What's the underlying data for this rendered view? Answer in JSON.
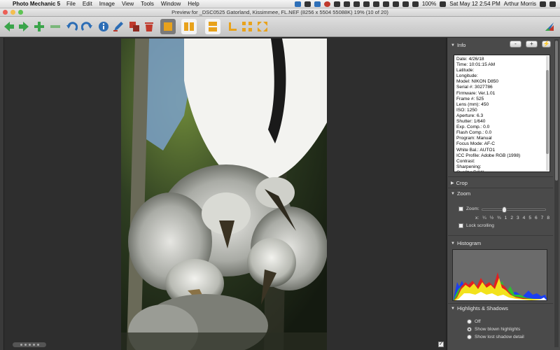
{
  "menubar": {
    "app_name": "Photo Mechanic 5",
    "items": [
      "File",
      "Edit",
      "Image",
      "View",
      "Tools",
      "Window",
      "Help"
    ],
    "battery": "100%",
    "datetime": "Sat May 12  2:54 PM",
    "user": "Arthur Morris"
  },
  "window": {
    "title": "Preview for _DSC0525 Gatorland, Kissimmee, FL.NEF (8256 x 5504 55088K) 19% (10 of 20)"
  },
  "toolbar": {
    "icons": [
      "back-arrow",
      "forward-arrow",
      "plus",
      "minus",
      "undo",
      "redo",
      "info",
      "edit-pen",
      "copy",
      "trash",
      "single-view",
      "split-vertical",
      "split-horizontal",
      "crop-corner",
      "shrink",
      "expand"
    ]
  },
  "info_panel": {
    "header": "Info",
    "buttons": {
      "minus": "-",
      "plus": "+",
      "action": "⚡"
    },
    "lines": [
      "Date: 4/26/18",
      "Time: 10:01:15 AM",
      "Latitude:",
      "Longitude:",
      "Model: NIKON D850",
      "Serial #: 3027786",
      "Firmware: Ver.1.01",
      "Frame #: 525",
      "Lens (mm): 450",
      "ISO: 1250",
      "Aperture: 6.3",
      "Shutter: 1/640",
      "Exp. Comp.: 0.0",
      "Flash Comp.: 0.0",
      "Program: Manual",
      "Focus Mode: AF-C",
      "White Bal.: AUTO1",
      "ICC Profile: Adobe RGB (1998)",
      "Contrast:",
      "Sharpening:",
      "Quality: RAW"
    ]
  },
  "crop_panel": {
    "header": "Crop"
  },
  "zoom_panel": {
    "header": "Zoom",
    "zoom_label": "Zoom:",
    "slider_fraction": 0.33,
    "ticks_prefix": "x:",
    "ticks": [
      "¼",
      "½",
      "¾",
      "1",
      "2",
      "3",
      "4",
      "5",
      "6",
      "7",
      "8"
    ],
    "lock_label": "Lock scrolling"
  },
  "histogram_panel": {
    "header": "Histogram"
  },
  "highlights_panel": {
    "header": "Highlights & Shadows",
    "options": [
      "Off",
      "Show blown highlights",
      "Show lost shadow detail"
    ],
    "selected": 1
  }
}
